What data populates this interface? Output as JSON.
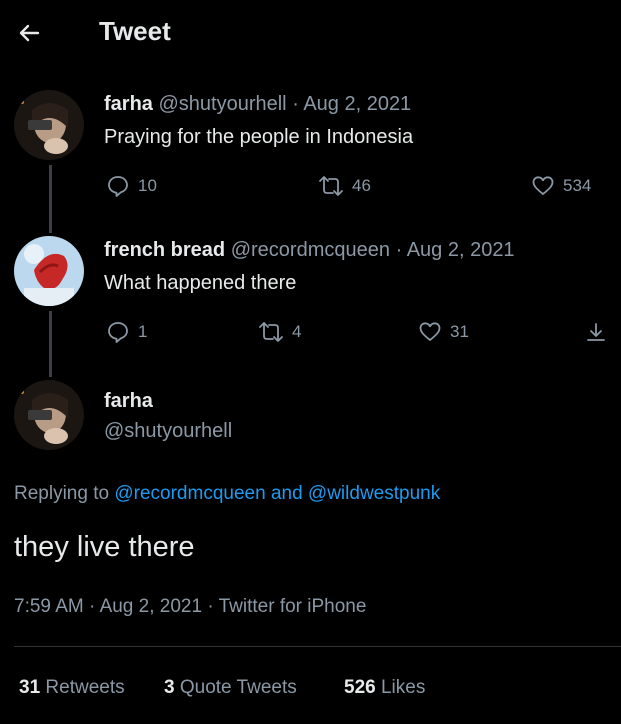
{
  "header": {
    "title": "Tweet",
    "back_icon": "arrow-left-icon"
  },
  "tweets": [
    {
      "name": "farha",
      "handle": "@shutyourhell",
      "separator": "·",
      "date": "Aug 2, 2021",
      "text": "Praying for the people in Indonesia",
      "replies": "10",
      "retweets": "46",
      "likes": "534"
    },
    {
      "name": "french bread",
      "handle": "@recordmcqueen",
      "separator": "·",
      "date": "Aug 2, 2021",
      "text": "What happened there",
      "replies": "1",
      "retweets": "4",
      "likes": "31"
    }
  ],
  "main_tweet": {
    "name": "farha",
    "handle": "@shutyourhell",
    "replying_prefix": "Replying to",
    "mention_1": "@recordmcqueen",
    "replying_and": "and",
    "mention_2": "@wildwestpunk",
    "text": "they live there",
    "time": "7:59 AM",
    "separator": "·",
    "date": "Aug 2, 2021",
    "source": "Twitter for iPhone"
  },
  "stats": {
    "retweets_count": "31",
    "retweets_label": "Retweets",
    "quotes_count": "3",
    "quotes_label": "Quote Tweets",
    "likes_count": "526",
    "likes_label": "Likes"
  },
  "colors": {
    "background": "#000000",
    "text": "#e7e9ea",
    "secondary": "#8b98a5",
    "link": "#1d9bf0",
    "divider": "#2f3336"
  }
}
